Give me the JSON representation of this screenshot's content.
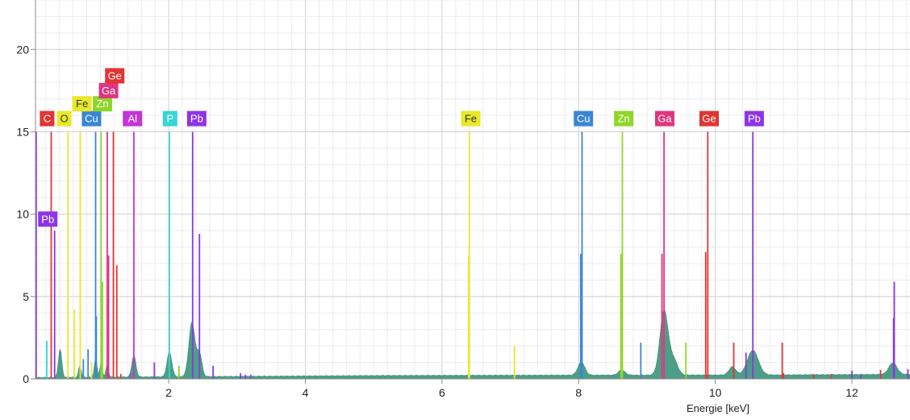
{
  "chart_data": {
    "type": "line",
    "title": "",
    "xlabel": "Energie [keV]",
    "ylabel": "",
    "xlim": [
      0.05,
      12.85
    ],
    "ylim": [
      0,
      23
    ],
    "x_ticks": [
      2,
      4,
      6,
      8,
      10,
      12
    ],
    "y_ticks": [
      0,
      5,
      10,
      15,
      20
    ],
    "grid": true,
    "spectrum": {
      "color": "#4c9e86",
      "baseline": [
        [
          0.05,
          0.08
        ],
        [
          1.5,
          0.12
        ],
        [
          3,
          0.15
        ],
        [
          5,
          0.2
        ],
        [
          7,
          0.22
        ],
        [
          9,
          0.23
        ],
        [
          11,
          0.24
        ],
        [
          12.85,
          0.28
        ]
      ],
      "peaks": [
        {
          "x": 0.41,
          "height": 1.7,
          "width": 0.025
        },
        {
          "x": 0.7,
          "height": 0.7,
          "width": 0.02
        },
        {
          "x": 0.93,
          "height": 1.1,
          "width": 0.02
        },
        {
          "x": 1.01,
          "height": 0.8,
          "width": 0.02
        },
        {
          "x": 1.1,
          "height": 0.7,
          "width": 0.02
        },
        {
          "x": 1.49,
          "height": 1.3,
          "width": 0.03
        },
        {
          "x": 2.01,
          "height": 1.5,
          "width": 0.035
        },
        {
          "x": 2.34,
          "height": 3.3,
          "width": 0.045
        },
        {
          "x": 2.45,
          "height": 1.4,
          "width": 0.035
        },
        {
          "x": 8.04,
          "height": 0.8,
          "width": 0.05
        },
        {
          "x": 8.63,
          "height": 0.3,
          "width": 0.05
        },
        {
          "x": 9.25,
          "height": 3.9,
          "width": 0.06
        },
        {
          "x": 9.39,
          "height": 0.9,
          "width": 0.06
        },
        {
          "x": 10.25,
          "height": 0.5,
          "width": 0.05
        },
        {
          "x": 10.55,
          "height": 1.5,
          "width": 0.08
        },
        {
          "x": 12.6,
          "height": 0.7,
          "width": 0.06
        }
      ]
    },
    "element_lines": [
      {
        "x": 0.06,
        "height": 15,
        "color": "#8e35e6"
      },
      {
        "x": 0.28,
        "height": 15,
        "color": "#e03535"
      },
      {
        "x": 0.525,
        "height": 15,
        "color": "#e8e82a"
      },
      {
        "x": 0.705,
        "height": 15,
        "color": "#e8e82a"
      },
      {
        "x": 0.93,
        "height": 15,
        "color": "#3a86d6"
      },
      {
        "x": 1.01,
        "height": 15,
        "color": "#8fd62a"
      },
      {
        "x": 1.1,
        "height": 15,
        "color": "#e0357f"
      },
      {
        "x": 1.19,
        "height": 15,
        "color": "#e03535"
      },
      {
        "x": 1.49,
        "height": 15,
        "color": "#c235d6"
      },
      {
        "x": 2.01,
        "height": 15,
        "color": "#35d6d6"
      },
      {
        "x": 2.35,
        "height": 15,
        "color": "#8e35e6"
      },
      {
        "x": 6.4,
        "height": 15,
        "color": "#e8e82a"
      },
      {
        "x": 8.05,
        "height": 15,
        "color": "#3a86d6"
      },
      {
        "x": 8.64,
        "height": 15,
        "color": "#8fd62a"
      },
      {
        "x": 9.25,
        "height": 15,
        "color": "#e0357f"
      },
      {
        "x": 9.89,
        "height": 15,
        "color": "#e03535"
      },
      {
        "x": 10.55,
        "height": 15,
        "color": "#8e35e6"
      },
      {
        "x": 0.215,
        "height": 2.3,
        "color": "#35d6d6"
      },
      {
        "x": 0.33,
        "height": 9,
        "color": "#8e35e6"
      },
      {
        "x": 0.62,
        "height": 4.2,
        "color": "#e8e82a"
      },
      {
        "x": 0.75,
        "height": 1.2,
        "color": "#3a86d6"
      },
      {
        "x": 0.82,
        "height": 1.8,
        "color": "#3a86d6"
      },
      {
        "x": 0.87,
        "height": 1.0,
        "color": "#e8e82a"
      },
      {
        "x": 0.94,
        "height": 3.8,
        "color": "#3a86d6"
      },
      {
        "x": 1.03,
        "height": 5.9,
        "color": "#8fd62a"
      },
      {
        "x": 1.12,
        "height": 7.5,
        "color": "#e0357f"
      },
      {
        "x": 1.24,
        "height": 6.9,
        "color": "#e03535"
      },
      {
        "x": 1.3,
        "height": 0.3,
        "color": "#e03535"
      },
      {
        "x": 1.44,
        "height": 0.3,
        "color": "#c235d6"
      },
      {
        "x": 1.79,
        "height": 1.0,
        "color": "#8e35e6"
      },
      {
        "x": 2.15,
        "height": 0.8,
        "color": "#8fd62a"
      },
      {
        "x": 2.45,
        "height": 8.8,
        "color": "#8e35e6"
      },
      {
        "x": 2.65,
        "height": 0.8,
        "color": "#8e35e6"
      },
      {
        "x": 3.05,
        "height": 0.35,
        "color": "#8e35e6"
      },
      {
        "x": 3.12,
        "height": 0.25,
        "color": "#8e35e6"
      },
      {
        "x": 3.2,
        "height": 0.25,
        "color": "#8e35e6"
      },
      {
        "x": 6.39,
        "height": 7.5,
        "color": "#e8e82a"
      },
      {
        "x": 7.06,
        "height": 2.0,
        "color": "#e8e82a"
      },
      {
        "x": 8.03,
        "height": 7.6,
        "color": "#3a86d6"
      },
      {
        "x": 8.62,
        "height": 7.6,
        "color": "#8fd62a"
      },
      {
        "x": 8.91,
        "height": 2.2,
        "color": "#3a86d6"
      },
      {
        "x": 9.22,
        "height": 7.6,
        "color": "#e0357f"
      },
      {
        "x": 9.57,
        "height": 2.2,
        "color": "#8fd62a"
      },
      {
        "x": 9.86,
        "height": 7.7,
        "color": "#e03535"
      },
      {
        "x": 10.27,
        "height": 2.2,
        "color": "#e03535"
      },
      {
        "x": 10.45,
        "height": 1.6,
        "color": "#8e35e6"
      },
      {
        "x": 10.98,
        "height": 2.2,
        "color": "#e03535"
      },
      {
        "x": 11.0,
        "height": 0.35,
        "color": "#e03535"
      },
      {
        "x": 11.44,
        "height": 0.3,
        "color": "#e03535"
      },
      {
        "x": 11.7,
        "height": 0.3,
        "color": "#e03535"
      },
      {
        "x": 12.0,
        "height": 0.5,
        "color": "#8e35e6"
      },
      {
        "x": 12.13,
        "height": 0.25,
        "color": "#8e35e6"
      },
      {
        "x": 12.42,
        "height": 0.55,
        "color": "#e03535"
      },
      {
        "x": 12.61,
        "height": 3.7,
        "color": "#8e35e6"
      },
      {
        "x": 12.62,
        "height": 5.9,
        "color": "#8e35e6"
      },
      {
        "x": 12.82,
        "height": 0.6,
        "color": "#8e35e6"
      }
    ],
    "labels": [
      {
        "text": "C",
        "x": 0.22,
        "y": 15.8,
        "color": "#e03535",
        "text_color": "#ffffff"
      },
      {
        "text": "O",
        "x": 0.47,
        "y": 15.8,
        "color": "#e8e82a",
        "text_color": "#333333"
      },
      {
        "text": "Cu",
        "x": 0.87,
        "y": 15.8,
        "color": "#3a86d6",
        "text_color": "#ffffff"
      },
      {
        "text": "Al",
        "x": 1.47,
        "y": 15.8,
        "color": "#c235d6",
        "text_color": "#ffffff"
      },
      {
        "text": "P",
        "x": 2.02,
        "y": 15.8,
        "color": "#35d6d6",
        "text_color": "#ffffff"
      },
      {
        "text": "Pb",
        "x": 2.41,
        "y": 15.8,
        "color": "#8e35e6",
        "text_color": "#ffffff"
      },
      {
        "text": "Fe",
        "x": 0.73,
        "y": 16.7,
        "color": "#e8e82a",
        "text_color": "#333333"
      },
      {
        "text": "Zn",
        "x": 1.03,
        "y": 16.7,
        "color": "#8fd62a",
        "text_color": "#ffffff"
      },
      {
        "text": "Ga",
        "x": 1.12,
        "y": 17.5,
        "color": "#e0357f",
        "text_color": "#ffffff"
      },
      {
        "text": "Ge",
        "x": 1.21,
        "y": 18.4,
        "color": "#e03535",
        "text_color": "#ffffff"
      },
      {
        "text": "Pb",
        "x": 0.23,
        "y": 9.7,
        "color": "#8e35e6",
        "text_color": "#ffffff"
      },
      {
        "text": "Fe",
        "x": 6.42,
        "y": 15.8,
        "color": "#e8e82a",
        "text_color": "#333333"
      },
      {
        "text": "Cu",
        "x": 8.07,
        "y": 15.8,
        "color": "#3a86d6",
        "text_color": "#ffffff"
      },
      {
        "text": "Zn",
        "x": 8.66,
        "y": 15.8,
        "color": "#8fd62a",
        "text_color": "#ffffff"
      },
      {
        "text": "Ga",
        "x": 9.26,
        "y": 15.8,
        "color": "#e0357f",
        "text_color": "#ffffff"
      },
      {
        "text": "Ge",
        "x": 9.91,
        "y": 15.8,
        "color": "#e03535",
        "text_color": "#ffffff"
      },
      {
        "text": "Pb",
        "x": 10.57,
        "y": 15.8,
        "color": "#8e35e6",
        "text_color": "#ffffff"
      }
    ]
  }
}
